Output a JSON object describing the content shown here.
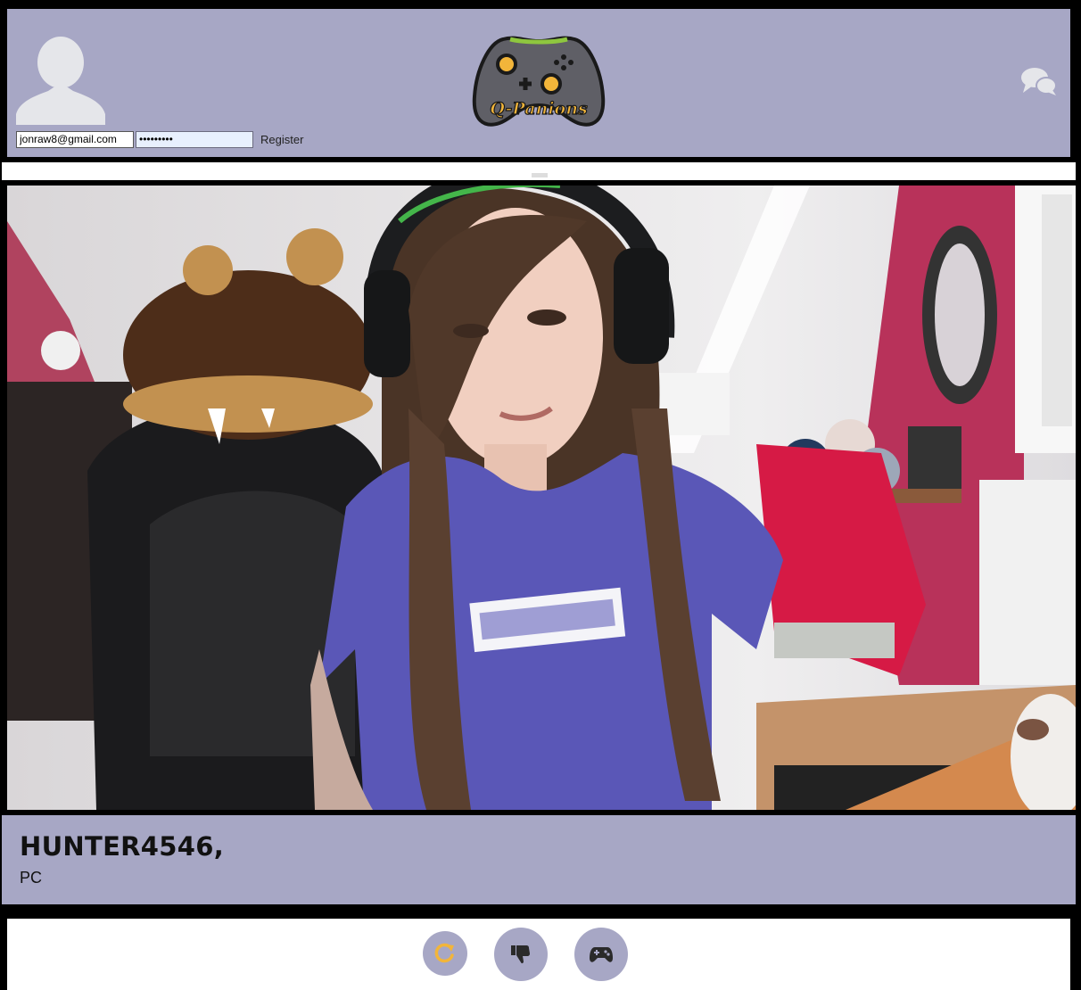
{
  "header": {
    "logo_text": "Q-Panions",
    "login": {
      "email_value": "jonraw8@gmail.com",
      "password_value": "•••••••••",
      "register_label": "Register"
    },
    "icons": {
      "avatar": "user-silhouette-icon",
      "chat": "chat-bubbles-icon"
    }
  },
  "profile": {
    "username": "HUNTER4546,",
    "platform": "PC"
  },
  "actions": [
    {
      "name": "refresh",
      "icon": "refresh-icon",
      "color": "#f2b53a"
    },
    {
      "name": "dislike",
      "icon": "thumbs-down-icon",
      "color": "#2a2a2a"
    },
    {
      "name": "game",
      "icon": "gamepad-icon",
      "color": "#2a2a2a"
    }
  ],
  "colors": {
    "panel": "#a7a7c5",
    "accent": "#f2b53a",
    "logo_trim": "#8ec63f"
  }
}
